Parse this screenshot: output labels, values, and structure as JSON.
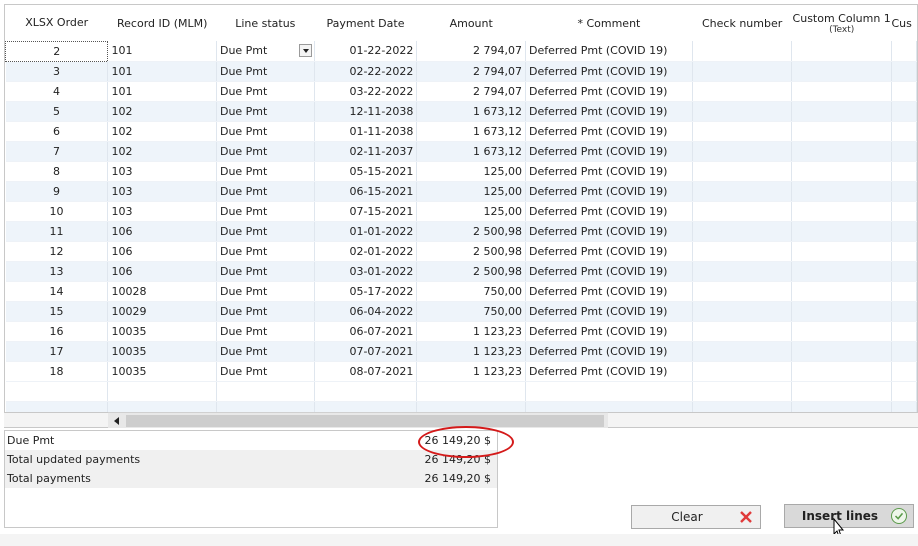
{
  "columns": [
    {
      "label": "XLSX Order"
    },
    {
      "label": "Record ID (MLM)"
    },
    {
      "label": "Line status"
    },
    {
      "label": "Payment Date"
    },
    {
      "label": "Amount"
    },
    {
      "label": "* Comment"
    },
    {
      "label": "Check number"
    },
    {
      "label": "Custom Column 1",
      "sub": "(Text)"
    },
    {
      "label": "Cus"
    }
  ],
  "rows": [
    {
      "order": "2",
      "record": "101",
      "status": "Due Pmt",
      "date": "01-22-2022",
      "amount": "2 794,07",
      "comment": "Deferred Pmt (COVID 19)"
    },
    {
      "order": "3",
      "record": "101",
      "status": "Due Pmt",
      "date": "02-22-2022",
      "amount": "2 794,07",
      "comment": "Deferred Pmt (COVID 19)"
    },
    {
      "order": "4",
      "record": "101",
      "status": "Due Pmt",
      "date": "03-22-2022",
      "amount": "2 794,07",
      "comment": "Deferred Pmt (COVID 19)"
    },
    {
      "order": "5",
      "record": "102",
      "status": "Due Pmt",
      "date": "12-11-2038",
      "amount": "1 673,12",
      "comment": "Deferred Pmt (COVID 19)"
    },
    {
      "order": "6",
      "record": "102",
      "status": "Due Pmt",
      "date": "01-11-2038",
      "amount": "1 673,12",
      "comment": "Deferred Pmt (COVID 19)"
    },
    {
      "order": "7",
      "record": "102",
      "status": "Due Pmt",
      "date": "02-11-2037",
      "amount": "1 673,12",
      "comment": "Deferred Pmt (COVID 19)"
    },
    {
      "order": "8",
      "record": "103",
      "status": "Due Pmt",
      "date": "05-15-2021",
      "amount": "125,00",
      "comment": "Deferred Pmt (COVID 19)"
    },
    {
      "order": "9",
      "record": "103",
      "status": "Due Pmt",
      "date": "06-15-2021",
      "amount": "125,00",
      "comment": "Deferred Pmt (COVID 19)"
    },
    {
      "order": "10",
      "record": "103",
      "status": "Due Pmt",
      "date": "07-15-2021",
      "amount": "125,00",
      "comment": "Deferred Pmt (COVID 19)"
    },
    {
      "order": "11",
      "record": "106",
      "status": "Due Pmt",
      "date": "01-01-2022",
      "amount": "2 500,98",
      "comment": "Deferred Pmt (COVID 19)"
    },
    {
      "order": "12",
      "record": "106",
      "status": "Due Pmt",
      "date": "02-01-2022",
      "amount": "2 500,98",
      "comment": "Deferred Pmt (COVID 19)"
    },
    {
      "order": "13",
      "record": "106",
      "status": "Due Pmt",
      "date": "03-01-2022",
      "amount": "2 500,98",
      "comment": "Deferred Pmt (COVID 19)"
    },
    {
      "order": "14",
      "record": "10028",
      "status": "Due Pmt",
      "date": "05-17-2022",
      "amount": "750,00",
      "comment": "Deferred Pmt (COVID 19)"
    },
    {
      "order": "15",
      "record": "10029",
      "status": "Due Pmt",
      "date": "06-04-2022",
      "amount": "750,00",
      "comment": "Deferred Pmt (COVID 19)"
    },
    {
      "order": "16",
      "record": "10035",
      "status": "Due Pmt",
      "date": "06-07-2021",
      "amount": "1 123,23",
      "comment": "Deferred Pmt (COVID 19)"
    },
    {
      "order": "17",
      "record": "10035",
      "status": "Due Pmt",
      "date": "07-07-2021",
      "amount": "1 123,23",
      "comment": "Deferred Pmt (COVID 19)"
    },
    {
      "order": "18",
      "record": "10035",
      "status": "Due Pmt",
      "date": "08-07-2021",
      "amount": "1 123,23",
      "comment": "Deferred Pmt (COVID 19)"
    }
  ],
  "totals": [
    {
      "label": "Due Pmt",
      "value": "26 149,20 $"
    },
    {
      "label": "Total updated payments",
      "value": "26 149,20 $"
    },
    {
      "label": "Total payments",
      "value": "26 149,20 $"
    }
  ],
  "buttons": {
    "clear": {
      "label": "Clear",
      "icon": "close-icon",
      "color": "#e03a3a"
    },
    "insert": {
      "label": "Insert lines",
      "icon": "check-circle-icon",
      "color": "#5a9a4a"
    }
  },
  "colors": {
    "alt_row": "#eef4fa",
    "highlight_ring": "#d41a1a"
  }
}
